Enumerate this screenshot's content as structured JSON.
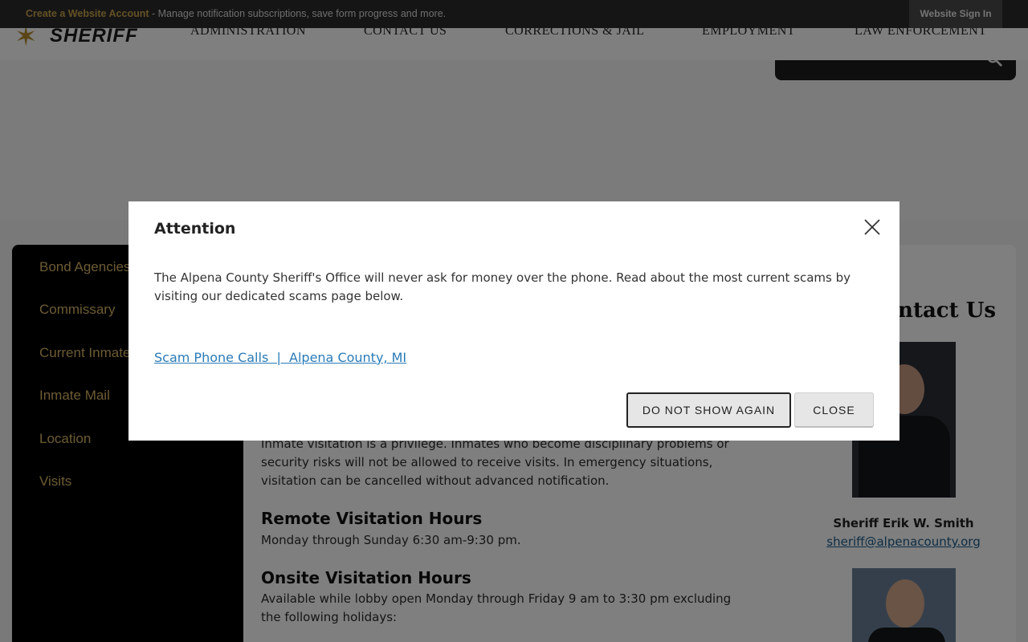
{
  "topbar": {
    "create_account": "Create a Website Account",
    "create_account_desc": " - Manage notification subscriptions, save form progress and more.",
    "sign_in": "Website Sign In"
  },
  "header": {
    "logo_text": "SHERIFF",
    "nav": [
      "ADMINISTRATION",
      "CONTACT US",
      "CORRECTIONS & JAIL",
      "EMPLOYMENT",
      "LAW ENFORCEMENT"
    ]
  },
  "sidebar": {
    "items": [
      "Bond Agencies",
      "Commissary",
      "Current Inmate",
      "Inmate Mail",
      "Location",
      "Visits"
    ]
  },
  "content": {
    "visitation_text": "Inmate visitation is a privilege. Inmates who become disciplinary problems or security risks will not be allowed to receive visits. In emergency situations, visitation can be cancelled without advanced notification.",
    "remote_heading": "Remote Visitation Hours",
    "remote_text": "Monday through Sunday 6:30 am-9:30 pm.",
    "onsite_heading": "Onsite Visitation Hours",
    "onsite_text": "Available while lobby open Monday through Friday 9 am to 3:30 pm excluding the following holidays:"
  },
  "contact": {
    "title": "Contact Us",
    "sheriff_name": "Sheriff Erik W. Smith",
    "sheriff_email": "sheriff@alpenacounty.org"
  },
  "modal": {
    "title": "Attention",
    "body": "The Alpena County Sheriff's Office will never ask for money over the phone. Read about the most current scams by visiting our dedicated scams page below.",
    "link_text": "Scam Phone Calls  |  Alpena County, MI",
    "do_not_show_label": "DO NOT SHOW AGAIN",
    "close_label": "CLOSE"
  },
  "colors": {
    "accent_gold": "#d8b667",
    "link_blue": "#2a7bb8"
  }
}
